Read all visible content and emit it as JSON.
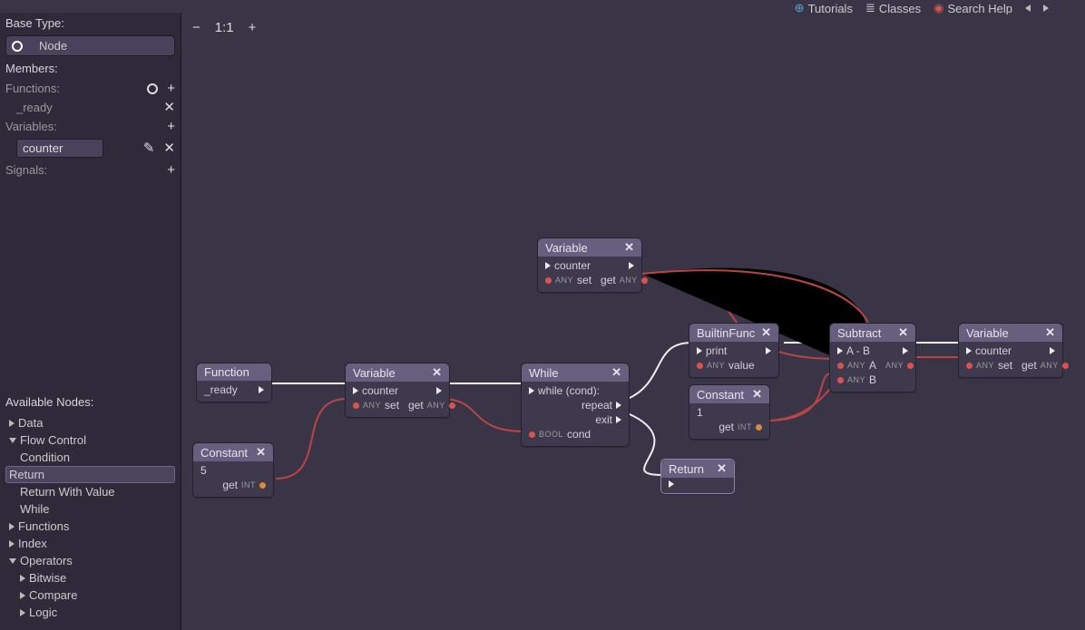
{
  "topbar": {
    "tutorials": "Tutorials",
    "classes": "Classes",
    "search": "Search Help"
  },
  "sidebar": {
    "base_type_label": "Base Type:",
    "base_type_value": "Node",
    "members_label": "Members:",
    "functions_label": "Functions:",
    "function_items": [
      "_ready"
    ],
    "variables_label": "Variables:",
    "variable_value": "counter",
    "signals_label": "Signals:",
    "available_label": "Available Nodes:",
    "tree": {
      "data": "Data",
      "flow_control": "Flow Control",
      "flow_children": {
        "condition": "Condition",
        "return": "Return",
        "return_with_value": "Return With Value",
        "while": "While"
      },
      "functions": "Functions",
      "index": "Index",
      "operators": "Operators",
      "op_children": {
        "bitwise": "Bitwise",
        "compare": "Compare",
        "logic": "Logic"
      }
    }
  },
  "toolbar": {
    "zoom": "1:1"
  },
  "nodes": {
    "function": {
      "title": "Function",
      "label": "_ready"
    },
    "constant5": {
      "title": "Constant",
      "value": "5",
      "get": "get",
      "type": "INT"
    },
    "variable1": {
      "title": "Variable",
      "name": "counter",
      "any": "ANY",
      "set": "set",
      "get": "get"
    },
    "variable_top": {
      "title": "Variable",
      "name": "counter",
      "any": "ANY",
      "set": "set",
      "get": "get"
    },
    "while": {
      "title": "While",
      "cond_line": "while (cond):",
      "repeat": "repeat",
      "exit": "exit",
      "bool": "BOOL",
      "cond": "cond"
    },
    "builtin": {
      "title": "BuiltinFunc",
      "print": "print",
      "any": "ANY",
      "value": "value"
    },
    "constant1": {
      "title": "Constant",
      "value": "1",
      "get": "get",
      "type": "INT"
    },
    "return": {
      "title": "Return"
    },
    "subtract": {
      "title": "Subtract",
      "expr": "A - B",
      "any": "ANY",
      "a": "A",
      "b": "B"
    },
    "variable3": {
      "title": "Variable",
      "name": "counter",
      "any": "ANY",
      "set": "set",
      "get": "get"
    }
  }
}
